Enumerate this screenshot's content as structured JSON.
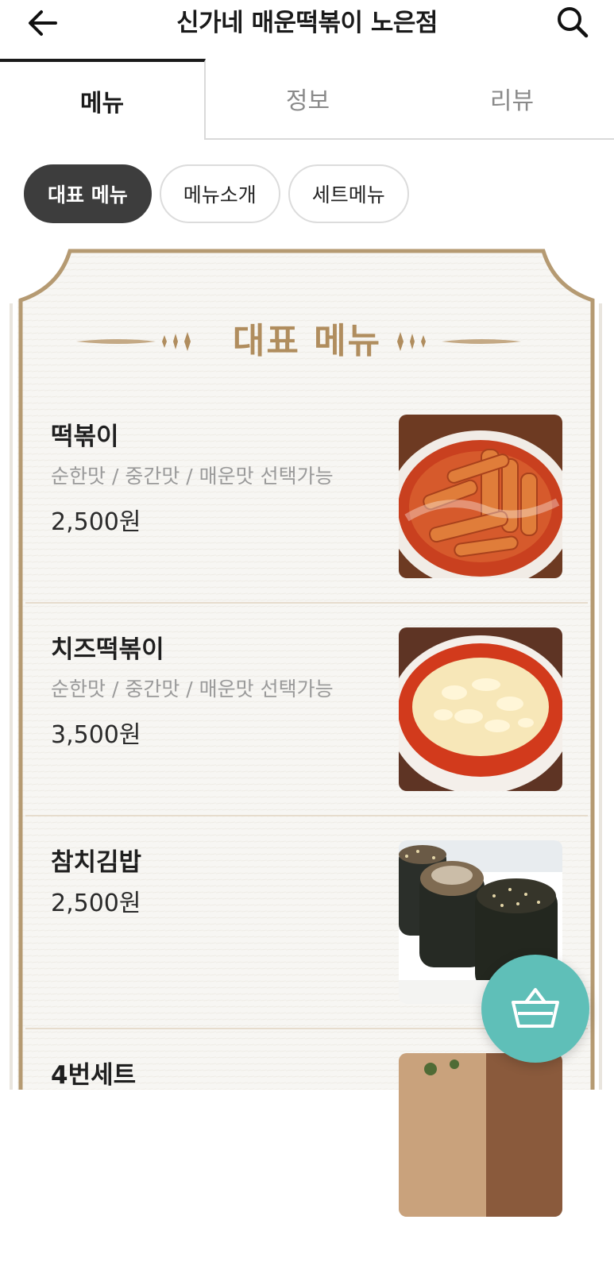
{
  "header": {
    "title": "신가네 매운떡볶이 노은점",
    "back_icon": "arrow-left-icon",
    "search_icon": "search-icon"
  },
  "tabs": [
    {
      "label": "메뉴",
      "active": true
    },
    {
      "label": "정보",
      "active": false
    },
    {
      "label": "리뷰",
      "active": false
    }
  ],
  "chips": [
    {
      "label": "대표 메뉴",
      "active": true
    },
    {
      "label": "메뉴소개",
      "active": false
    },
    {
      "label": "세트메뉴",
      "active": false
    }
  ],
  "board": {
    "title": "대표 메뉴",
    "items": [
      {
        "name": "떡볶이",
        "desc": "순한맛 / 중간맛 / 매운맛 선택가능",
        "price": "2,500원",
        "image": "tteokbokki-photo"
      },
      {
        "name": "치즈떡볶이",
        "desc": "순한맛 / 중간맛 / 매운맛 선택가능",
        "price": "3,500원",
        "image": "cheese-tteokbokki-photo"
      },
      {
        "name": "참치김밥",
        "desc": "",
        "price": "2,500원",
        "image": "tuna-kimbap-photo"
      },
      {
        "name": "4번세트",
        "desc": "",
        "price": "",
        "image": "set-photo"
      }
    ]
  },
  "cart": {
    "icon": "basket-icon"
  },
  "colors": {
    "accent": "#5fbfb8",
    "gold": "#b08d5e",
    "chip_active": "#3d3d3d"
  }
}
